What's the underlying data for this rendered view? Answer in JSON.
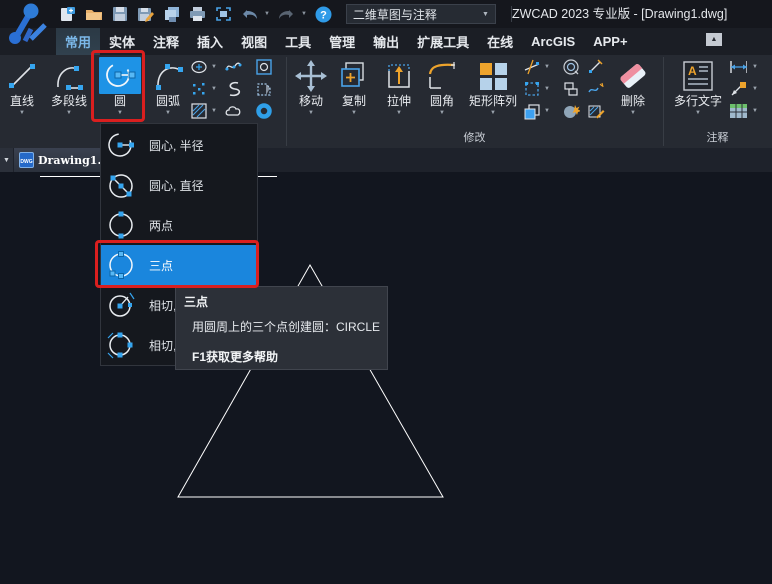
{
  "window": {
    "title": "ZWCAD 2023 专业版 - [Drawing1.dwg]"
  },
  "quick_access": {
    "workspace": "二维草图与注释",
    "icons": [
      "new-file",
      "open-folder",
      "save",
      "save-as",
      "copy-sheets",
      "plot",
      "preview",
      "undo",
      "redo",
      "help"
    ]
  },
  "tabs": [
    {
      "label": "常用",
      "active": true
    },
    {
      "label": "实体"
    },
    {
      "label": "注释"
    },
    {
      "label": "插入"
    },
    {
      "label": "视图"
    },
    {
      "label": "工具"
    },
    {
      "label": "管理"
    },
    {
      "label": "输出"
    },
    {
      "label": "扩展工具"
    },
    {
      "label": "在线"
    },
    {
      "label": "ArcGIS"
    },
    {
      "label": "APP+"
    }
  ],
  "ribbon": {
    "draw": {
      "buttons": [
        {
          "label": "直线"
        },
        {
          "label": "多段线"
        },
        {
          "label": "圆",
          "highlighted": true
        },
        {
          "label": "圆弧"
        }
      ]
    },
    "modify": {
      "label": "修改",
      "buttons": [
        {
          "label": "移动"
        },
        {
          "label": "复制"
        },
        {
          "label": "拉伸"
        },
        {
          "label": "圆角"
        },
        {
          "label": "矩形阵列"
        },
        {
          "label": "删除"
        }
      ]
    },
    "annotate": {
      "label": "注释",
      "buttons": [
        {
          "label": "多行文字"
        }
      ]
    }
  },
  "document_tabs": {
    "active": "Drawing1.",
    "badge": "DWG"
  },
  "circle_menu": {
    "items": [
      {
        "label": "圆心, 半径"
      },
      {
        "label": "圆心, 直径"
      },
      {
        "label": "两点"
      },
      {
        "label": "三点",
        "highlighted": true
      },
      {
        "label": "相切,"
      },
      {
        "label": "相切,"
      }
    ]
  },
  "tooltip": {
    "title": "三点",
    "description": "用圆周上的三个点创建圆：CIRCLE",
    "footer": "F1获取更多帮助"
  },
  "colors": {
    "highlight_blue": "#1a86dd",
    "button_highlight": "#1e93e6",
    "annotation_red": "#da1f1f",
    "grip_blue": "#35a5ef",
    "accent_orange": "#eda32c",
    "ribbon_bg": "#262a32",
    "canvas_bg": "#12161f"
  }
}
